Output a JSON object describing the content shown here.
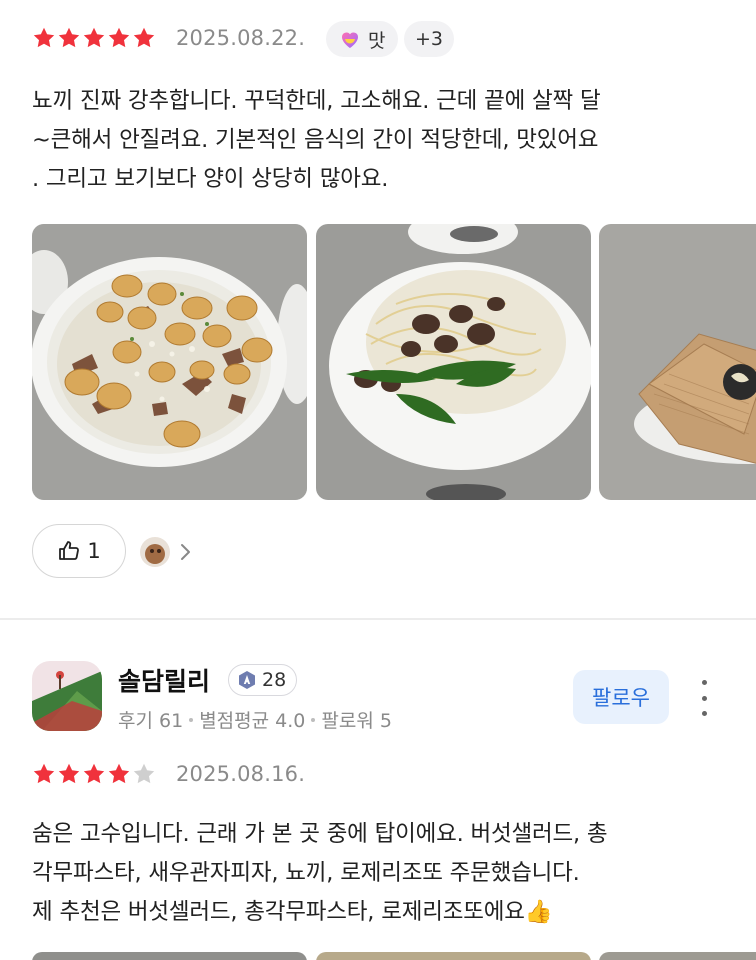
{
  "review1": {
    "rating": 5,
    "date": "2025.08.22.",
    "tag_label": "맛",
    "more_tags": "+3",
    "text_lines": [
      "뇨끼 진짜 강추합니다. 꾸덕한데, 고소해요. 근데 끝에 살짝 달",
      "~큰해서 안질려요. 기본적인 음식의 간이 적당한데, 맛있어요",
      ". 그리고 보기보다 양이 상당히 많아요."
    ],
    "photos": [
      "gnocchi-photo",
      "mushroom-pasta-photo",
      "dessert-photo"
    ],
    "like_count": "1"
  },
  "review2": {
    "username": "솔담릴리",
    "level": "28",
    "stats": {
      "reviews": "후기 61",
      "avg_rating": "별점평균 4.0",
      "followers": "팔로워 5"
    },
    "follow_label": "팔로우",
    "rating": 4,
    "date": "2025.08.16.",
    "text_lines": [
      "숨은 고수입니다. 근래 가 본 곳 중에 탑이에요. 버섯샐러드, 총",
      "각무파스타, 새우관자피자, 뇨끼, 로제리조또 주문했습니다.",
      "제 추천은 버섯셀러드, 총각무파스타, 로제리조또에요"
    ],
    "emoji": "👍"
  },
  "colors": {
    "star_filled": "#f0323c",
    "star_empty": "#cfcfcf",
    "follow_text": "#2a6fdb",
    "follow_bg": "#e8f1fd"
  }
}
